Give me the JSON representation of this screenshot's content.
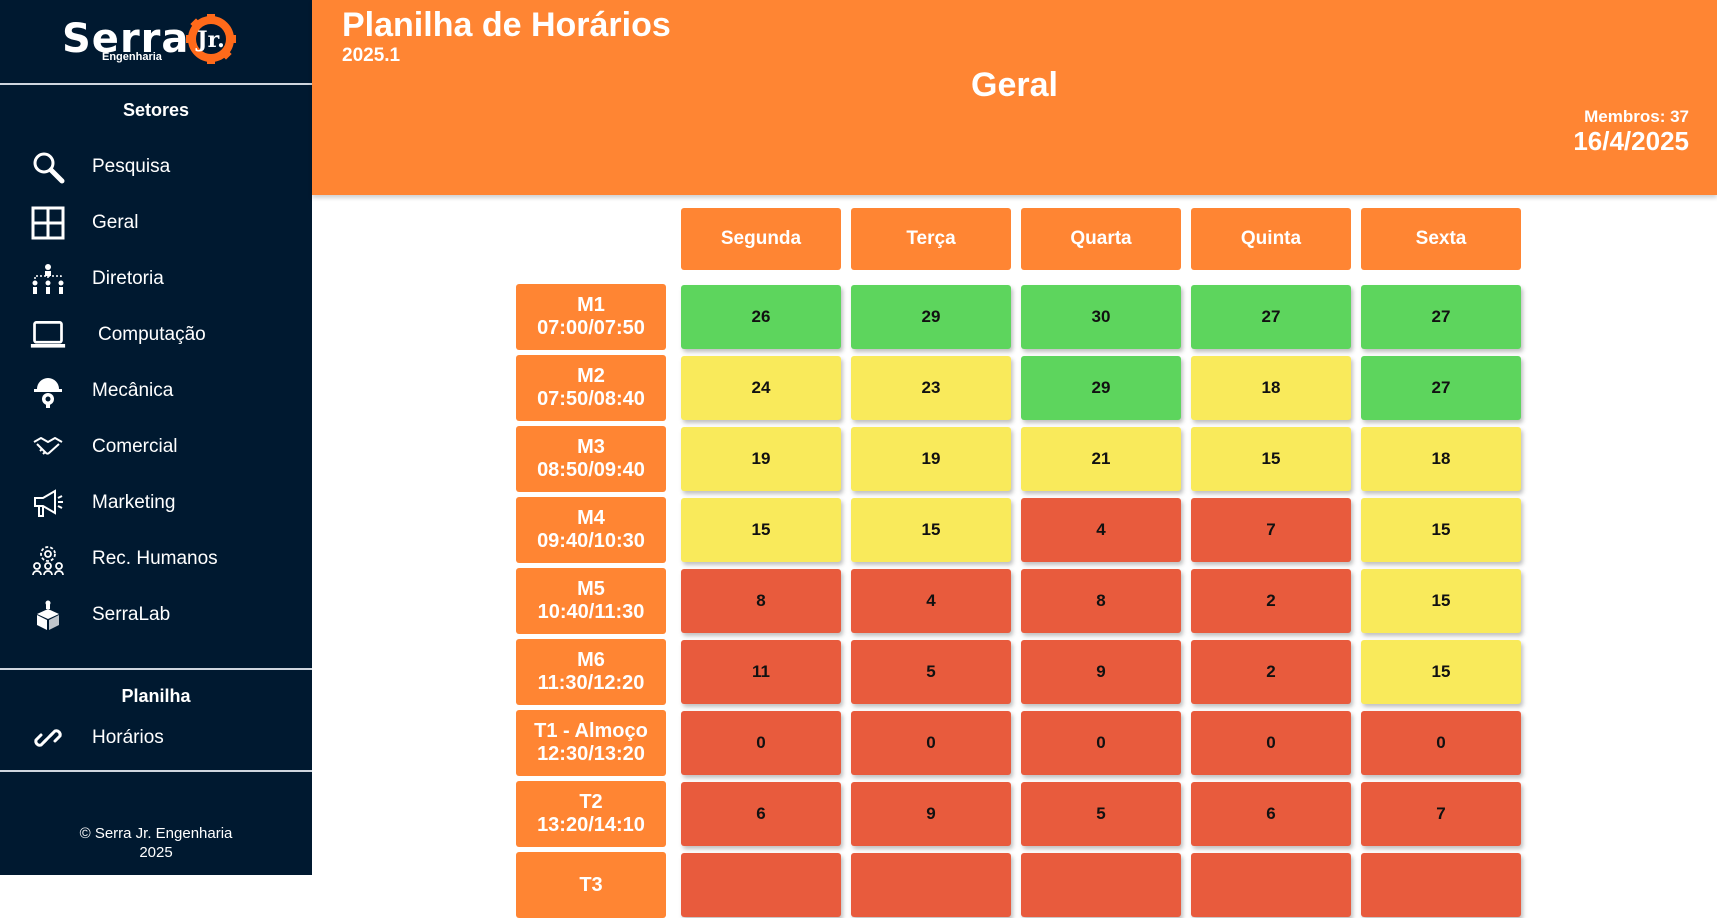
{
  "sidebar": {
    "logo": {
      "name": "Serra",
      "mark": "Jr.",
      "sub": "Engenharia"
    },
    "sectors_title": "Setores",
    "sectors": [
      {
        "label": "Pesquisa",
        "icon": "search-icon"
      },
      {
        "label": "Geral",
        "icon": "grid-icon"
      },
      {
        "label": "Diretoria",
        "icon": "org-chart-icon"
      },
      {
        "label": "Computação",
        "icon": "laptop-icon"
      },
      {
        "label": "Mecânica",
        "icon": "hardhat-gear-icon"
      },
      {
        "label": "Comercial",
        "icon": "handshake-icon"
      },
      {
        "label": "Marketing",
        "icon": "megaphone-icon"
      },
      {
        "label": "Rec. Humanos",
        "icon": "people-gear-icon"
      },
      {
        "label": "SerraLab",
        "icon": "lab-box-icon"
      }
    ],
    "sheet_title": "Planilha",
    "sheet_items": [
      {
        "label": "Horários",
        "icon": "link-icon"
      }
    ],
    "footer_line1": "© Serra Jr. Engenharia",
    "footer_line2": "2025"
  },
  "header": {
    "title": "Planilha de Horários",
    "semester": "2025.1",
    "sector": "Geral",
    "members": "Membros: 37",
    "date": "16/4/2025"
  },
  "colors": {
    "green": "#5dd55d",
    "yellow": "#f9ea5b",
    "red": "#e85b3d",
    "orange": "#ff8533"
  },
  "days": [
    "Segunda",
    "Terça",
    "Quarta",
    "Quinta",
    "Sexta"
  ],
  "slots": [
    {
      "code": "M1",
      "time": "07:00/07:50",
      "values": [
        26,
        29,
        30,
        27,
        27
      ],
      "levels": [
        "green",
        "green",
        "green",
        "green",
        "green"
      ]
    },
    {
      "code": "M2",
      "time": "07:50/08:40",
      "values": [
        24,
        23,
        29,
        18,
        27
      ],
      "levels": [
        "yellow",
        "yellow",
        "green",
        "yellow",
        "green"
      ]
    },
    {
      "code": "M3",
      "time": "08:50/09:40",
      "values": [
        19,
        19,
        21,
        15,
        18
      ],
      "levels": [
        "yellow",
        "yellow",
        "yellow",
        "yellow",
        "yellow"
      ]
    },
    {
      "code": "M4",
      "time": "09:40/10:30",
      "values": [
        15,
        15,
        4,
        7,
        15
      ],
      "levels": [
        "yellow",
        "yellow",
        "red",
        "red",
        "yellow"
      ]
    },
    {
      "code": "M5",
      "time": "10:40/11:30",
      "values": [
        8,
        4,
        8,
        2,
        15
      ],
      "levels": [
        "red",
        "red",
        "red",
        "red",
        "yellow"
      ]
    },
    {
      "code": "M6",
      "time": "11:30/12:20",
      "values": [
        11,
        5,
        9,
        2,
        15
      ],
      "levels": [
        "red",
        "red",
        "red",
        "red",
        "yellow"
      ]
    },
    {
      "code": "T1 - Almoço",
      "time": "12:30/13:20",
      "values": [
        0,
        0,
        0,
        0,
        0
      ],
      "levels": [
        "red",
        "red",
        "red",
        "red",
        "red"
      ]
    },
    {
      "code": "T2",
      "time": "13:20/14:10",
      "values": [
        6,
        9,
        5,
        6,
        7
      ],
      "levels": [
        "red",
        "red",
        "red",
        "red",
        "red"
      ]
    },
    {
      "code": "T3",
      "time": "",
      "values": [
        "",
        "",
        "",
        "",
        ""
      ],
      "levels": [
        "red",
        "red",
        "red",
        "red",
        "red"
      ]
    }
  ]
}
